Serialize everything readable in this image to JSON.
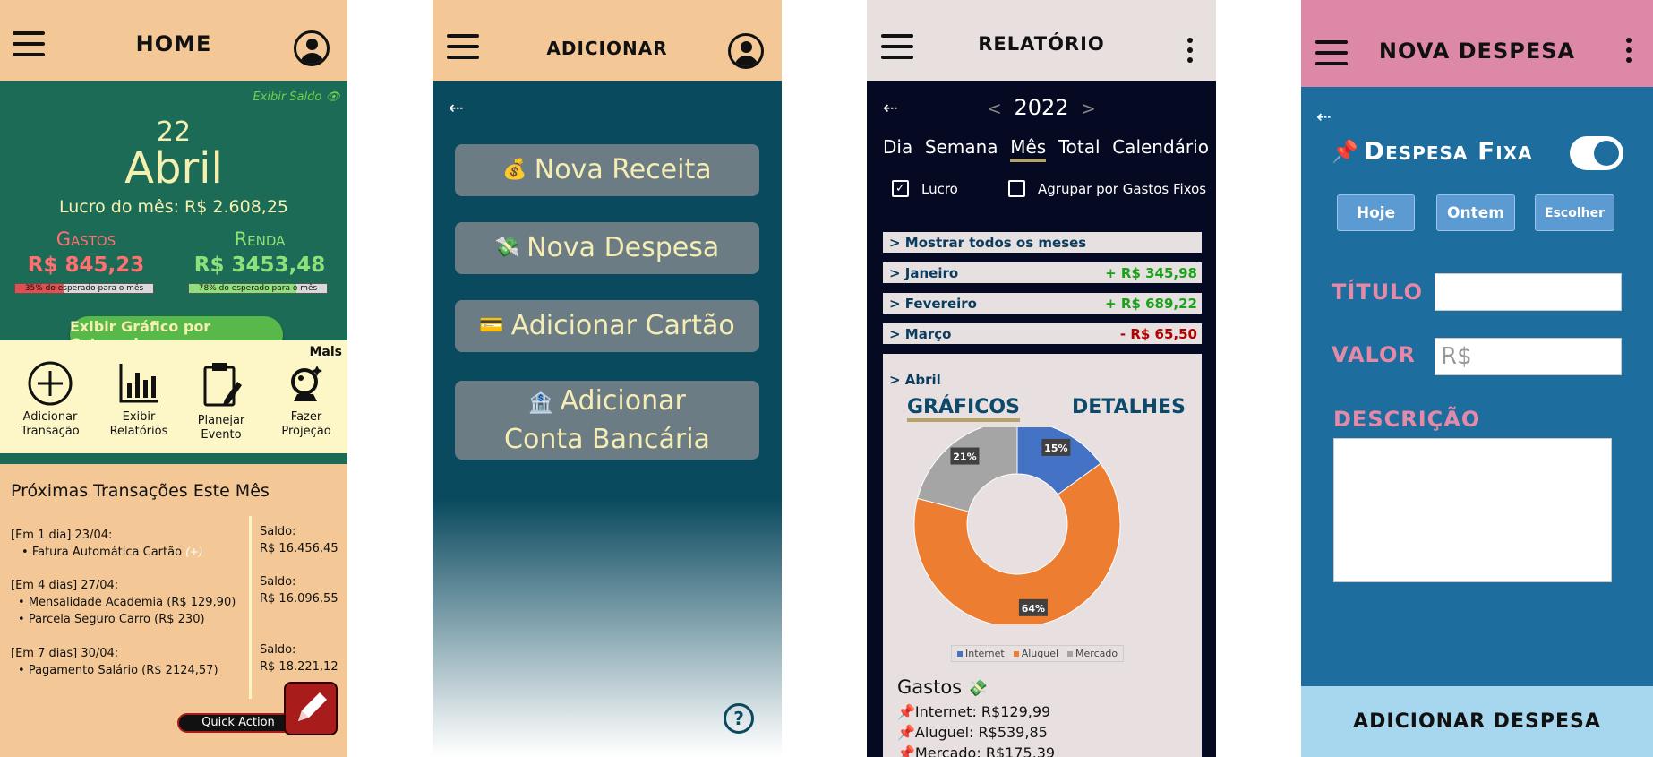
{
  "home": {
    "title": "HOME",
    "show_balance": "Exibir Saldo",
    "day": "22",
    "month": "Abril",
    "profit": "Lucro do mês: R$ 2.608,25",
    "expenses_label": "Gastos",
    "expenses_value": "R$ 845,23",
    "expenses_hint": "35% do esperado para o mês",
    "expenses_progress": 0.35,
    "income_label": "Renda",
    "income_value": "R$ 3453,48",
    "income_hint": "78% do esperado para o mês",
    "income_progress": 0.78,
    "chart_button": "Exibir Gráfico por Categoria",
    "more_link": "Mais",
    "actions": [
      {
        "icon": "plus-circle-icon",
        "line1": "Adicionar",
        "line2": "Transação"
      },
      {
        "icon": "bar-chart-icon",
        "line1": "Exibir",
        "line2": "Relatórios"
      },
      {
        "icon": "clipboard-edit-icon",
        "line1": "Planejar",
        "line2": "Evento"
      },
      {
        "icon": "crystal-ball-icon",
        "line1": "Fazer",
        "line2": "Projeção"
      }
    ],
    "upcoming_title": "Próximas Transações Este Mês",
    "groups": [
      {
        "head": "[Em 1 dia] 23/04:",
        "items": [
          "Fatura Automática Cartão"
        ],
        "extra": "(+)",
        "saldo_label": "Saldo:",
        "saldo": "R$ 16.456,45"
      },
      {
        "head": "[Em 4 dias] 27/04:",
        "items": [
          "Mensalidade Academia  (R$ 129,90)",
          "Parcela Seguro Carro  (R$ 230)"
        ],
        "extra": "",
        "saldo_label": "Saldo:",
        "saldo": "R$ 16.096,55"
      },
      {
        "head": "[Em 7 dias] 30/04:",
        "items": [
          "Pagamento Salário (R$ 2124,57)"
        ],
        "extra": "",
        "saldo_label": "Saldo:",
        "saldo": "R$ 18.221,12"
      }
    ],
    "quick_action": "Quick Action"
  },
  "add": {
    "title": "ADICIONAR",
    "buttons": [
      {
        "emoji": "💰",
        "label": "Nova Receita"
      },
      {
        "emoji": "💸",
        "label": "Nova Despesa"
      },
      {
        "emoji": "💳",
        "label": "Adicionar Cartão"
      },
      {
        "emoji": "🏦",
        "label": "Adicionar",
        "label2": "Conta Bancária"
      }
    ],
    "help_icon": "?"
  },
  "report": {
    "title": "RELATÓRIO",
    "year": "2022",
    "prev": "<",
    "next": ">",
    "tabs": [
      "Dia",
      "Semana",
      "Mês",
      "Total",
      "Calendário"
    ],
    "active_tab": "Mês",
    "check_profit": "Lucro",
    "check_group": "Agrupar por Gastos Fixos",
    "show_all": "> Mostrar todos os meses",
    "months": [
      {
        "name": "> Janeiro",
        "value": "+ R$ 345,98",
        "color": "#1aa31a"
      },
      {
        "name": "> Fevereiro",
        "value": "+ R$ 689,22",
        "color": "#1aa31a"
      },
      {
        "name": "> Março",
        "value": "- R$ 65,50",
        "color": "#b00000"
      }
    ],
    "april": "> Abril",
    "tab_charts": "GRÁFICOS",
    "tab_details": "DETALHES",
    "expenses_title": "Gastos",
    "expenses": [
      "Internet: R$129,99",
      "Aluguel: R$539,85",
      "Mercado: R$175,39"
    ]
  },
  "chart_data": {
    "type": "pie",
    "categories": [
      "Internet",
      "Aluguel",
      "Mercado"
    ],
    "values": [
      15,
      64,
      21
    ],
    "labels": [
      "15%",
      "64%",
      "21%"
    ],
    "colors": [
      "#4472c4",
      "#ed7d31",
      "#a5a5a5"
    ],
    "legend": "bottom"
  },
  "expense": {
    "title": "NOVA DESPESA",
    "fixed_label": "Despesa Fixa",
    "toggle_on": true,
    "date_buttons": [
      "Hoje",
      "Ontem",
      "Escolher"
    ],
    "title_label": "TÍTULO",
    "value_label": "VALOR",
    "value_placeholder": "R$",
    "desc_label": "DESCRIÇÃO",
    "submit": "ADICIONAR DESPESA"
  },
  "colors": {
    "peach": "#f3c896",
    "green": "#1c6b56",
    "navy": "#0a4a5f",
    "dark": "#050a22",
    "pink": "#dd88a6",
    "blue": "#1d6e9e"
  }
}
